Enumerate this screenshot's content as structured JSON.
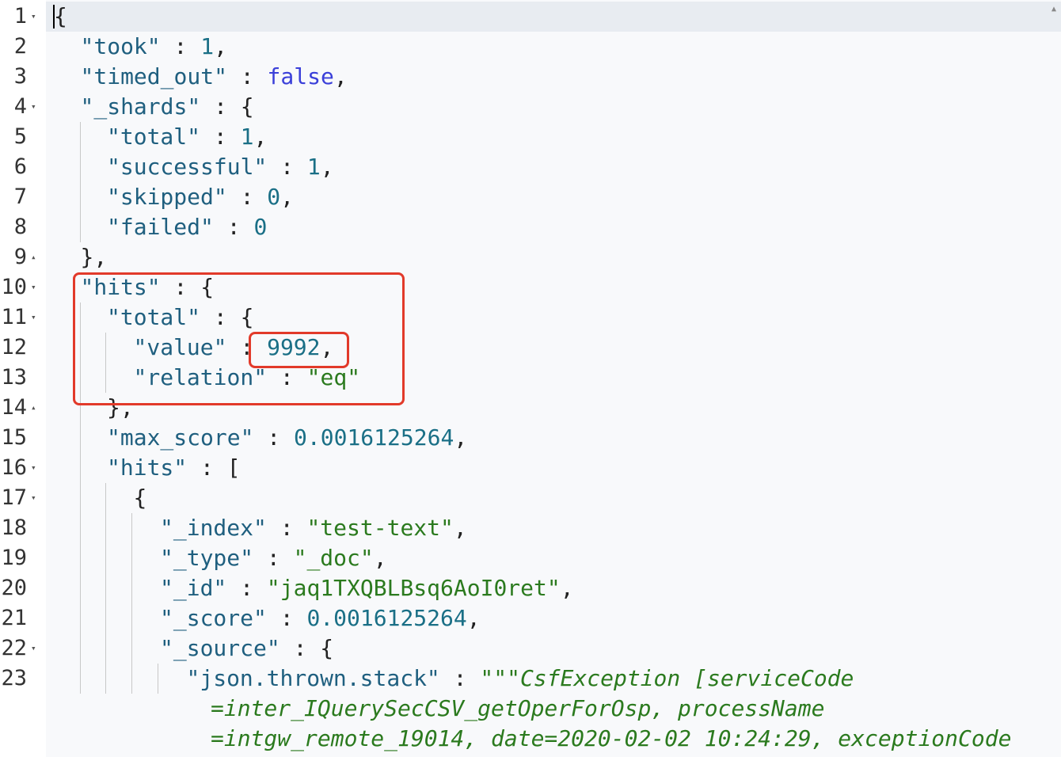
{
  "editor": {
    "lines": [
      {
        "n": "1",
        "fold": "▾",
        "indent": 0,
        "html": [
          {
            "t": "{",
            "c": "p"
          }
        ]
      },
      {
        "n": "2",
        "fold": "",
        "indent": 1,
        "html": [
          {
            "t": "\"took\"",
            "c": "k"
          },
          {
            "t": " : ",
            "c": "p"
          },
          {
            "t": "1",
            "c": "n"
          },
          {
            "t": ",",
            "c": "p"
          }
        ]
      },
      {
        "n": "3",
        "fold": "",
        "indent": 1,
        "html": [
          {
            "t": "\"timed_out\"",
            "c": "k"
          },
          {
            "t": " : ",
            "c": "p"
          },
          {
            "t": "false",
            "c": "b"
          },
          {
            "t": ",",
            "c": "p"
          }
        ]
      },
      {
        "n": "4",
        "fold": "▾",
        "indent": 1,
        "html": [
          {
            "t": "\"_shards\"",
            "c": "k"
          },
          {
            "t": " : {",
            "c": "p"
          }
        ]
      },
      {
        "n": "5",
        "fold": "",
        "indent": 2,
        "html": [
          {
            "t": "\"total\"",
            "c": "k"
          },
          {
            "t": " : ",
            "c": "p"
          },
          {
            "t": "1",
            "c": "n"
          },
          {
            "t": ",",
            "c": "p"
          }
        ]
      },
      {
        "n": "6",
        "fold": "",
        "indent": 2,
        "html": [
          {
            "t": "\"successful\"",
            "c": "k"
          },
          {
            "t": " : ",
            "c": "p"
          },
          {
            "t": "1",
            "c": "n"
          },
          {
            "t": ",",
            "c": "p"
          }
        ]
      },
      {
        "n": "7",
        "fold": "",
        "indent": 2,
        "html": [
          {
            "t": "\"skipped\"",
            "c": "k"
          },
          {
            "t": " : ",
            "c": "p"
          },
          {
            "t": "0",
            "c": "n"
          },
          {
            "t": ",",
            "c": "p"
          }
        ]
      },
      {
        "n": "8",
        "fold": "",
        "indent": 2,
        "html": [
          {
            "t": "\"failed\"",
            "c": "k"
          },
          {
            "t": " : ",
            "c": "p"
          },
          {
            "t": "0",
            "c": "n"
          }
        ]
      },
      {
        "n": "9",
        "fold": "▴",
        "indent": 1,
        "html": [
          {
            "t": "},",
            "c": "p"
          }
        ]
      },
      {
        "n": "10",
        "fold": "▾",
        "indent": 1,
        "html": [
          {
            "t": "\"hits\"",
            "c": "k"
          },
          {
            "t": " : {",
            "c": "p"
          }
        ]
      },
      {
        "n": "11",
        "fold": "▾",
        "indent": 2,
        "html": [
          {
            "t": "\"total\"",
            "c": "k"
          },
          {
            "t": " : {",
            "c": "p"
          }
        ]
      },
      {
        "n": "12",
        "fold": "",
        "indent": 3,
        "html": [
          {
            "t": "\"value\"",
            "c": "k"
          },
          {
            "t": " : ",
            "c": "p"
          },
          {
            "t": "9992",
            "c": "n"
          },
          {
            "t": ",",
            "c": "p"
          }
        ]
      },
      {
        "n": "13",
        "fold": "",
        "indent": 3,
        "html": [
          {
            "t": "\"relation\"",
            "c": "k"
          },
          {
            "t": " : ",
            "c": "p"
          },
          {
            "t": "\"eq\"",
            "c": "s"
          }
        ]
      },
      {
        "n": "14",
        "fold": "▴",
        "indent": 2,
        "html": [
          {
            "t": "},",
            "c": "p"
          }
        ]
      },
      {
        "n": "15",
        "fold": "",
        "indent": 2,
        "html": [
          {
            "t": "\"max_score\"",
            "c": "k"
          },
          {
            "t": " : ",
            "c": "p"
          },
          {
            "t": "0.0016125264",
            "c": "n"
          },
          {
            "t": ",",
            "c": "p"
          }
        ]
      },
      {
        "n": "16",
        "fold": "▾",
        "indent": 2,
        "html": [
          {
            "t": "\"hits\"",
            "c": "k"
          },
          {
            "t": " : [",
            "c": "p"
          }
        ]
      },
      {
        "n": "17",
        "fold": "▾",
        "indent": 3,
        "html": [
          {
            "t": "{",
            "c": "p"
          }
        ]
      },
      {
        "n": "18",
        "fold": "",
        "indent": 4,
        "html": [
          {
            "t": "\"_index\"",
            "c": "k"
          },
          {
            "t": " : ",
            "c": "p"
          },
          {
            "t": "\"test-text\"",
            "c": "s"
          },
          {
            "t": ",",
            "c": "p"
          }
        ]
      },
      {
        "n": "19",
        "fold": "",
        "indent": 4,
        "html": [
          {
            "t": "\"_type\"",
            "c": "k"
          },
          {
            "t": " : ",
            "c": "p"
          },
          {
            "t": "\"_doc\"",
            "c": "s"
          },
          {
            "t": ",",
            "c": "p"
          }
        ]
      },
      {
        "n": "20",
        "fold": "",
        "indent": 4,
        "html": [
          {
            "t": "\"_id\"",
            "c": "k"
          },
          {
            "t": " : ",
            "c": "p"
          },
          {
            "t": "\"jaq1TXQBLBsq6AoI0ret\"",
            "c": "s"
          },
          {
            "t": ",",
            "c": "p"
          }
        ]
      },
      {
        "n": "21",
        "fold": "",
        "indent": 4,
        "html": [
          {
            "t": "\"_score\"",
            "c": "k"
          },
          {
            "t": " : ",
            "c": "p"
          },
          {
            "t": "0.0016125264",
            "c": "n"
          },
          {
            "t": ",",
            "c": "p"
          }
        ]
      },
      {
        "n": "22",
        "fold": "▾",
        "indent": 4,
        "html": [
          {
            "t": "\"_source\"",
            "c": "k"
          },
          {
            "t": " : {",
            "c": "p"
          }
        ]
      },
      {
        "n": "23",
        "fold": "",
        "indent": 5,
        "html": [
          {
            "t": "\"json.thrown.stack\"",
            "c": "k"
          },
          {
            "t": " : ",
            "c": "p"
          },
          {
            "t": "\"\"\"",
            "c": "s"
          },
          {
            "t": "CsfException [serviceCode",
            "c": "st"
          }
        ]
      },
      {
        "n": "",
        "fold": "",
        "indent": 6,
        "html": [
          {
            "t": "=inter_IQuerySecCSV_getOperForOsp, processName",
            "c": "st"
          }
        ]
      },
      {
        "n": "",
        "fold": "",
        "indent": 6,
        "html": [
          {
            "t": "=intgw_remote_19014, date=2020-02-02 10:24:29, exceptionCode",
            "c": "st"
          }
        ]
      }
    ]
  }
}
